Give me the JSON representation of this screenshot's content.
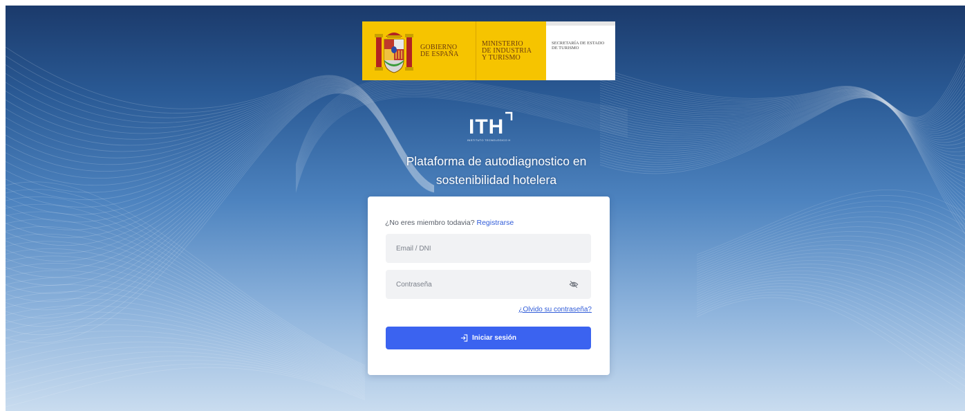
{
  "government": {
    "line1": "Gobierno",
    "line2": "de España",
    "ministry_line1": "Ministerio",
    "ministry_line2": "de Industria",
    "ministry_line3": "y Turismo",
    "secretary_line1": "Secretaría de Estado",
    "secretary_line2": "de Turismo"
  },
  "brand": {
    "logo_text": "ITH",
    "logo_subtext": "INSTITUTO TECNOLÓGICO HOTELERO"
  },
  "platform": {
    "title_line1": "Plataforma de autodiagnostico en",
    "title_line2": "sostenibilidad hotelera"
  },
  "login": {
    "register_prompt": "¿No eres miembro todavia?",
    "register_link": "Registrarse",
    "email_placeholder": "Email / DNI",
    "password_placeholder": "Contraseña",
    "forgot_password": "¿Olvido su contraseña?",
    "submit_label": "Iniciar sesión"
  },
  "colors": {
    "primary_button": "#3b63f0",
    "link": "#2f5bd8",
    "government_yellow": "#f6c400",
    "background_top": "#1b3a6b",
    "background_bottom": "#c9dcef"
  },
  "icons": {
    "password_toggle": "eye-off-icon",
    "login": "sign-in-icon",
    "coat_of_arms": "coat-of-arms-icon"
  }
}
